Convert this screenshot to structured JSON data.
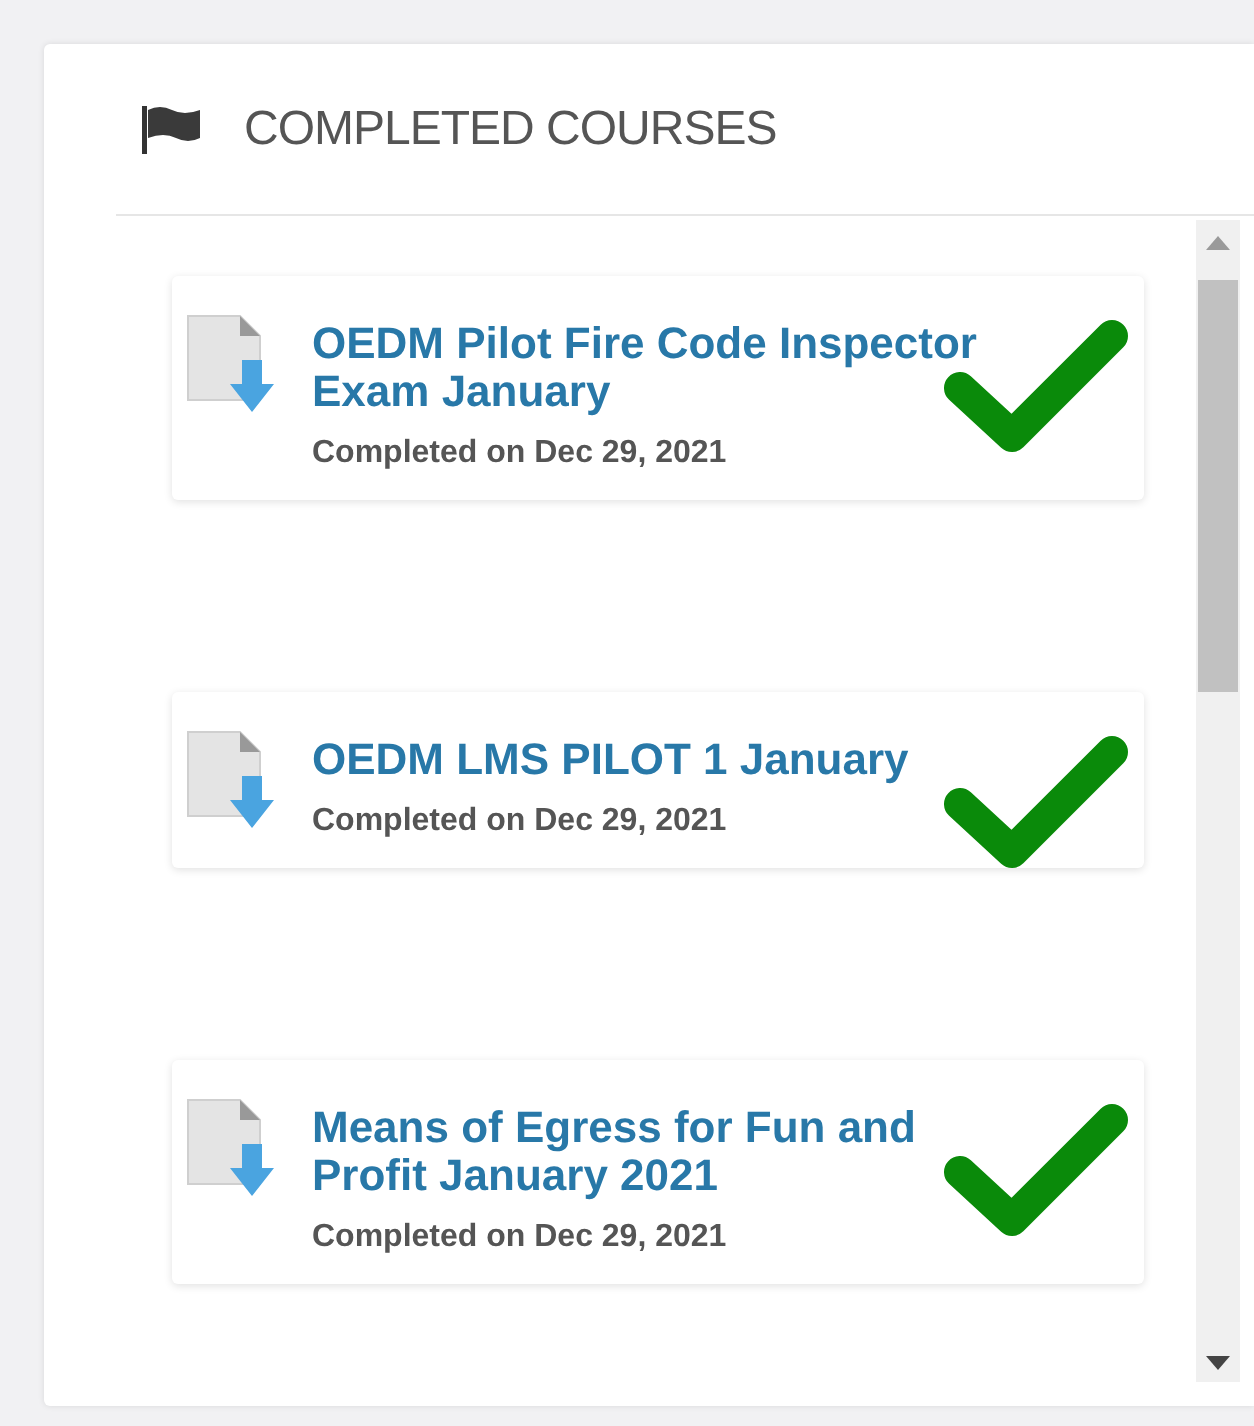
{
  "panel": {
    "title": "COMPLETED COURSES"
  },
  "courses": [
    {
      "title": "OEDM Pilot Fire Code Inspector Exam January",
      "completed_text": "Completed on Dec 29, 2021",
      "completed": true
    },
    {
      "title": "OEDM LMS PILOT 1 January",
      "completed_text": "Completed on Dec 29, 2021",
      "completed": true
    },
    {
      "title": "Means of Egress for Fun and Profit January 2021",
      "completed_text": "Completed on Dec 29, 2021",
      "completed": true
    }
  ]
}
